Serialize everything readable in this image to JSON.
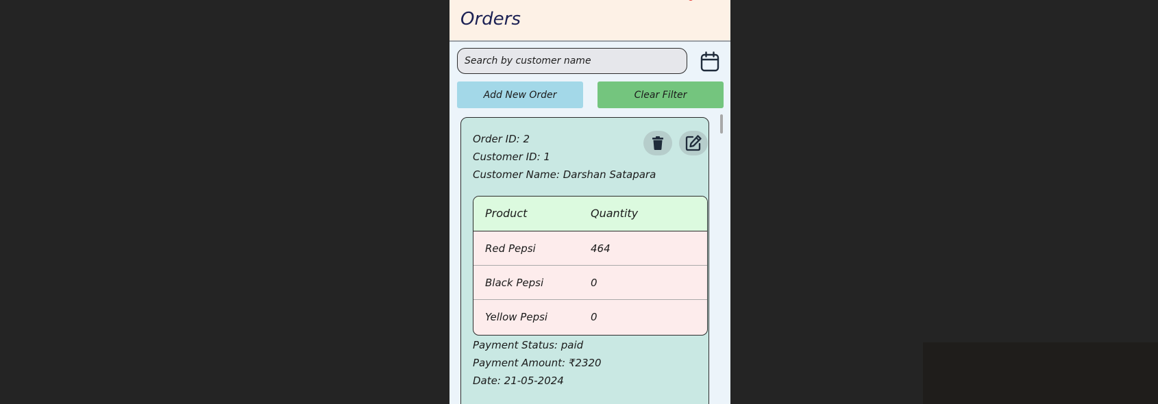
{
  "app": {
    "title": "Orders"
  },
  "search": {
    "placeholder": "Search by customer name",
    "value": ""
  },
  "actions": {
    "add_label": "Add New Order",
    "clear_label": "Clear Filter"
  },
  "colors": {
    "topbar_bg": "#fdf1e6",
    "title": "#1c2154",
    "add_button": "#a3d8e8",
    "clear_button": "#74c57e",
    "card_bg": "#c9e8e3",
    "table_header": "#dcfadf",
    "table_row": "#fdecec"
  },
  "icons": {
    "calendar": "calendar-icon",
    "delete": "trash-icon",
    "edit": "edit-icon"
  },
  "orders": [
    {
      "order_id_line": "Order ID: 2",
      "customer_id_line": "Customer ID: 1",
      "customer_name_line": "Customer Name: Darshan Satapara",
      "table": {
        "headers": [
          "Product",
          "Quantity"
        ],
        "rows": [
          {
            "product": "Red Pepsi",
            "quantity": "464"
          },
          {
            "product": "Black Pepsi",
            "quantity": "0"
          },
          {
            "product": "Yellow Pepsi",
            "quantity": "0"
          }
        ]
      },
      "payment_status_line": "Payment Status: paid",
      "payment_amount_line": "Payment Amount: ₹2320",
      "date_line": "Date: 21-05-2024"
    }
  ]
}
